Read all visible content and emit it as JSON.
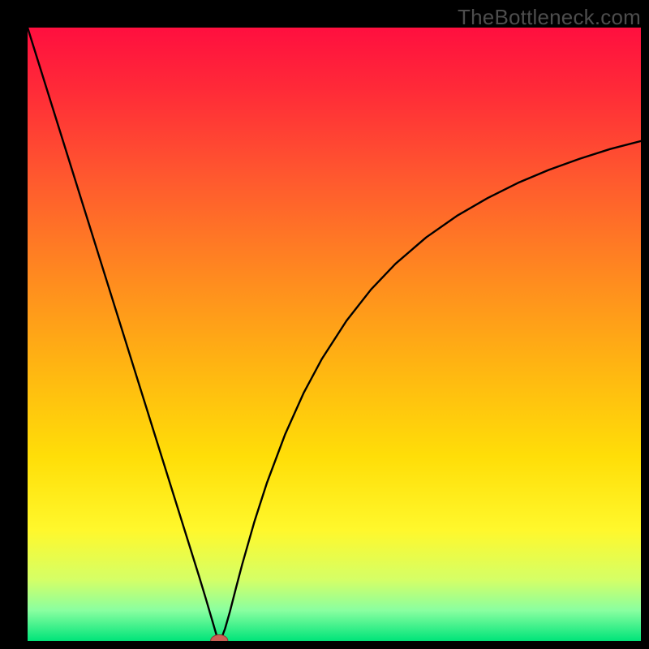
{
  "watermark": "TheBottleneck.com",
  "chart_data": {
    "type": "line",
    "title": "",
    "xlabel": "",
    "ylabel": "",
    "xlim": [
      0,
      100
    ],
    "ylim": [
      0,
      100
    ],
    "grid": false,
    "background_gradient": {
      "stops": [
        {
          "offset": 0.0,
          "color": "#ff0f3f"
        },
        {
          "offset": 0.1,
          "color": "#ff2a38"
        },
        {
          "offset": 0.25,
          "color": "#ff5a2e"
        },
        {
          "offset": 0.4,
          "color": "#ff8820"
        },
        {
          "offset": 0.55,
          "color": "#ffb412"
        },
        {
          "offset": 0.7,
          "color": "#ffde08"
        },
        {
          "offset": 0.82,
          "color": "#fff82c"
        },
        {
          "offset": 0.9,
          "color": "#d5ff66"
        },
        {
          "offset": 0.95,
          "color": "#8affa0"
        },
        {
          "offset": 1.0,
          "color": "#00e47a"
        }
      ]
    },
    "series": [
      {
        "name": "curve",
        "color": "#000000",
        "width": 2.4,
        "points": [
          [
            0.0,
            100.0
          ],
          [
            2.0,
            93.6
          ],
          [
            4.0,
            87.2
          ],
          [
            6.0,
            80.8
          ],
          [
            8.0,
            74.4
          ],
          [
            10.0,
            68.0
          ],
          [
            12.0,
            61.6
          ],
          [
            14.0,
            55.2
          ],
          [
            16.0,
            48.8
          ],
          [
            18.0,
            42.4
          ],
          [
            20.0,
            36.0
          ],
          [
            22.0,
            29.6
          ],
          [
            24.0,
            23.2
          ],
          [
            26.0,
            16.8
          ],
          [
            28.0,
            10.4
          ],
          [
            29.0,
            7.1
          ],
          [
            30.0,
            3.7
          ],
          [
            30.7,
            1.3
          ],
          [
            31.0,
            0.3
          ],
          [
            31.25,
            0.0
          ],
          [
            31.6,
            0.4
          ],
          [
            32.2,
            2.0
          ],
          [
            33.0,
            4.8
          ],
          [
            34.0,
            8.7
          ],
          [
            35.0,
            12.5
          ],
          [
            37.0,
            19.5
          ],
          [
            39.0,
            25.7
          ],
          [
            42.0,
            33.7
          ],
          [
            45.0,
            40.4
          ],
          [
            48.0,
            46.0
          ],
          [
            52.0,
            52.2
          ],
          [
            56.0,
            57.3
          ],
          [
            60.0,
            61.5
          ],
          [
            65.0,
            65.8
          ],
          [
            70.0,
            69.3
          ],
          [
            75.0,
            72.2
          ],
          [
            80.0,
            74.7
          ],
          [
            85.0,
            76.8
          ],
          [
            90.0,
            78.6
          ],
          [
            95.0,
            80.2
          ],
          [
            100.0,
            81.5
          ]
        ]
      }
    ],
    "marker": {
      "x": 31.25,
      "y": 0.0,
      "rx": 1.4,
      "ry": 1.0,
      "fill": "#cd5f55",
      "stroke": "#8a3a33"
    }
  }
}
